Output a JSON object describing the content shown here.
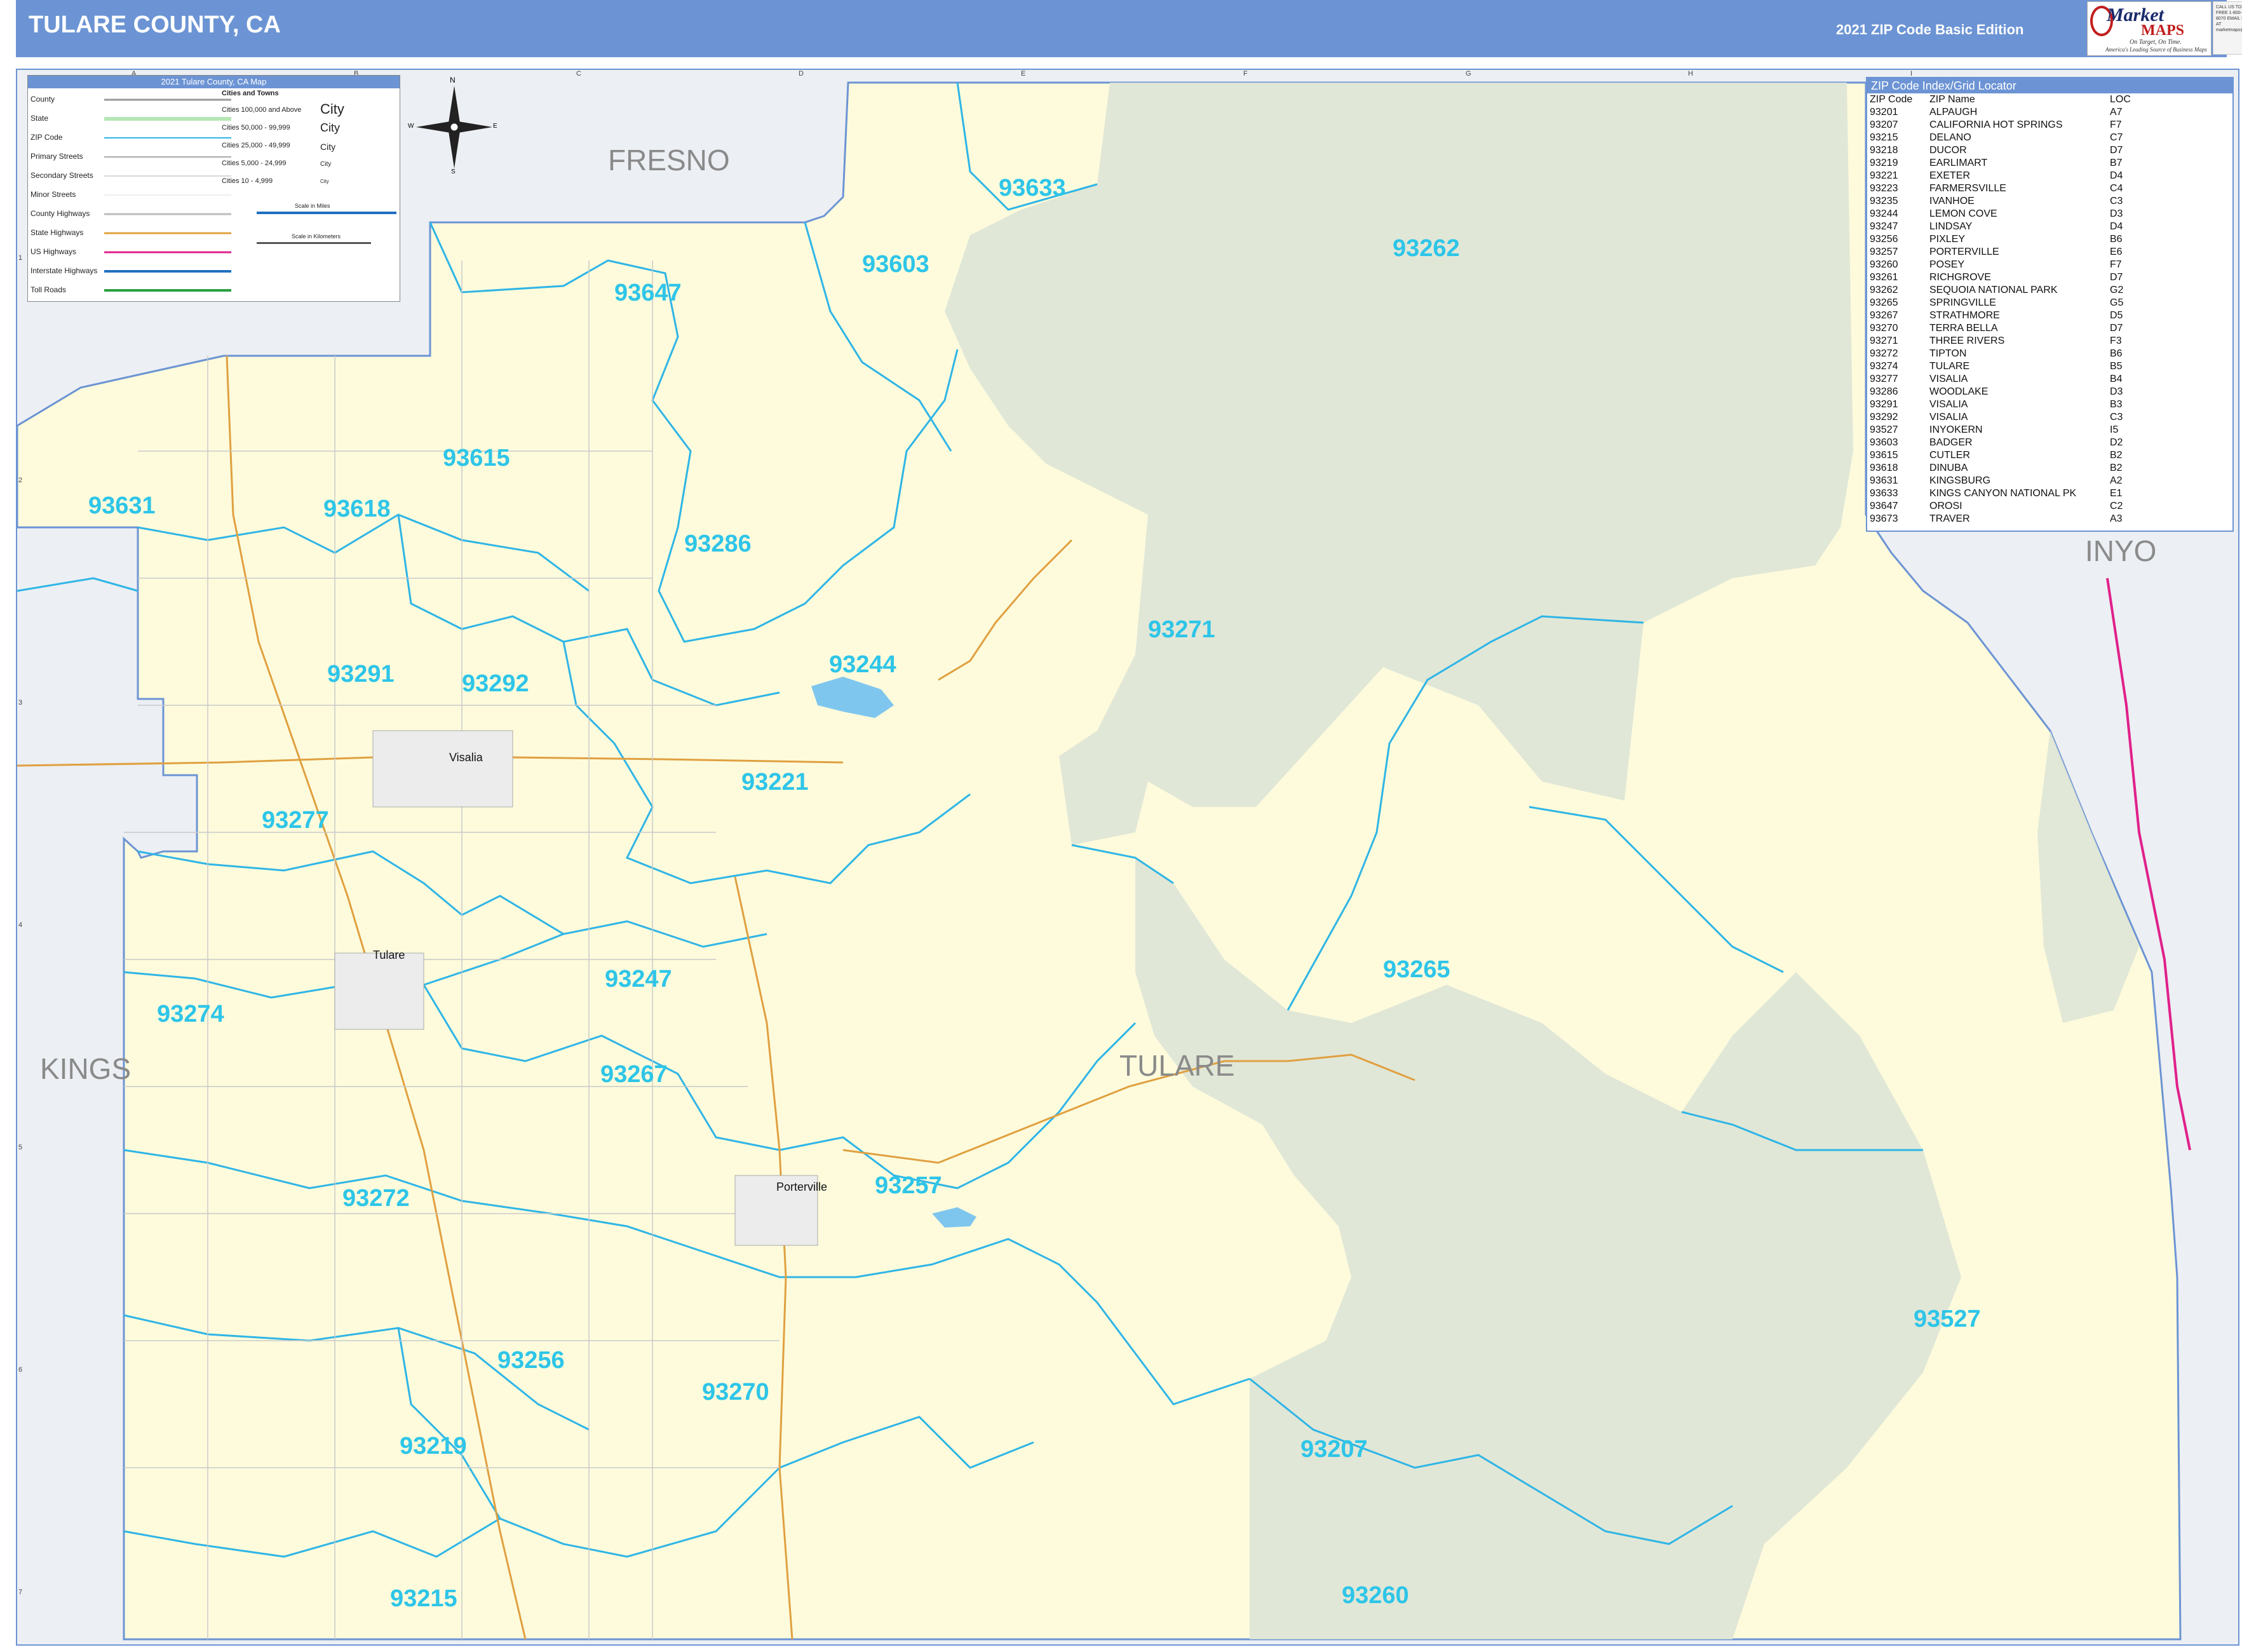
{
  "header": {
    "title": "TULARE COUNTY, CA",
    "edition": "2021 ZIP Code Basic Edition",
    "logo_brand": "Market",
    "logo_maps": "MAPS",
    "logo_tagline1": "On Target, On Time.",
    "logo_tagline2": "America's Leading Source of Business Maps",
    "contact": "CALL US TOLL FREE 1-800-334-8070 EMAIL US AT marketmaps@marketmaps.com"
  },
  "colors": {
    "header": "#6c94d4",
    "county_fill": "#fdfbdc",
    "forest_fill": "#dfe6d6",
    "outside_fill": "#eceff3",
    "zip_boundary": "#2fb5e6",
    "zip_label": "#2ec5e8",
    "state_highway": "#e0a040",
    "us_highway": "#e0208a"
  },
  "legend": {
    "title": "2021 Tulare County, CA Map",
    "items": [
      "County",
      "State",
      "ZIP Code",
      "Primary Streets",
      "Secondary Streets",
      "Minor Streets",
      "County Highways",
      "State Highways",
      "US Highways",
      "Interstate Highways",
      "Toll Roads"
    ],
    "cities_title": "Cities and Towns",
    "city_classes": [
      "Cities 100,000 and Above",
      "Cities 50,000 - 99,999",
      "Cities 25,000 - 49,999",
      "Cities 5,000 - 24,999",
      "Cities 10 - 4,999"
    ],
    "city_samples": [
      "City",
      "City",
      "City",
      "City",
      "City"
    ],
    "scale_miles": "Scale in Miles",
    "scale_km": "Scale in Kilometers"
  },
  "compass": {
    "n": "N",
    "s": "S",
    "e": "E",
    "w": "W"
  },
  "grid": {
    "columns": [
      "A",
      "B",
      "C",
      "D",
      "E",
      "F",
      "G",
      "H",
      "I"
    ],
    "rows": [
      "1",
      "2",
      "3",
      "4",
      "5",
      "6",
      "7"
    ]
  },
  "regions": [
    "FRESNO",
    "INYO",
    "KINGS",
    "TULARE"
  ],
  "zip_labels": [
    "93633",
    "93603",
    "93647",
    "93262",
    "93615",
    "93631",
    "93618",
    "93286",
    "93271",
    "93244",
    "93291",
    "93292",
    "93221",
    "93277",
    "93265",
    "93247",
    "93274",
    "93267",
    "93257",
    "93272",
    "93527",
    "93256",
    "93270",
    "93207",
    "93219",
    "93215",
    "93260"
  ],
  "cities": [
    "Visalia",
    "Tulare",
    "Porterville"
  ],
  "zip_index": {
    "title": "ZIP Code Index/Grid Locator",
    "headers": [
      "ZIP Code",
      "ZIP Name",
      "LOC"
    ],
    "rows": [
      [
        "93201",
        "ALPAUGH",
        "A7"
      ],
      [
        "93207",
        "CALIFORNIA HOT SPRINGS",
        "F7"
      ],
      [
        "93215",
        "DELANO",
        "C7"
      ],
      [
        "93218",
        "DUCOR",
        "D7"
      ],
      [
        "93219",
        "EARLIMART",
        "B7"
      ],
      [
        "93221",
        "EXETER",
        "D4"
      ],
      [
        "93223",
        "FARMERSVILLE",
        "C4"
      ],
      [
        "93235",
        "IVANHOE",
        "C3"
      ],
      [
        "93244",
        "LEMON COVE",
        "D3"
      ],
      [
        "93247",
        "LINDSAY",
        "D4"
      ],
      [
        "93256",
        "PIXLEY",
        "B6"
      ],
      [
        "93257",
        "PORTERVILLE",
        "E6"
      ],
      [
        "93260",
        "POSEY",
        "F7"
      ],
      [
        "93261",
        "RICHGROVE",
        "D7"
      ],
      [
        "93262",
        "SEQUOIA NATIONAL PARK",
        "G2"
      ],
      [
        "93265",
        "SPRINGVILLE",
        "G5"
      ],
      [
        "93267",
        "STRATHMORE",
        "D5"
      ],
      [
        "93270",
        "TERRA BELLA",
        "D7"
      ],
      [
        "93271",
        "THREE RIVERS",
        "F3"
      ],
      [
        "93272",
        "TIPTON",
        "B6"
      ],
      [
        "93274",
        "TULARE",
        "B5"
      ],
      [
        "93277",
        "VISALIA",
        "B4"
      ],
      [
        "93286",
        "WOODLAKE",
        "D3"
      ],
      [
        "93291",
        "VISALIA",
        "B3"
      ],
      [
        "93292",
        "VISALIA",
        "C3"
      ],
      [
        "93527",
        "INYOKERN",
        "I5"
      ],
      [
        "93603",
        "BADGER",
        "D2"
      ],
      [
        "93615",
        "CUTLER",
        "B2"
      ],
      [
        "93618",
        "DINUBA",
        "B2"
      ],
      [
        "93631",
        "KINGSBURG",
        "A2"
      ],
      [
        "93633",
        "KINGS CANYON NATIONAL PK",
        "E1"
      ],
      [
        "93647",
        "OROSI",
        "C2"
      ],
      [
        "93673",
        "TRAVER",
        "A3"
      ]
    ]
  }
}
